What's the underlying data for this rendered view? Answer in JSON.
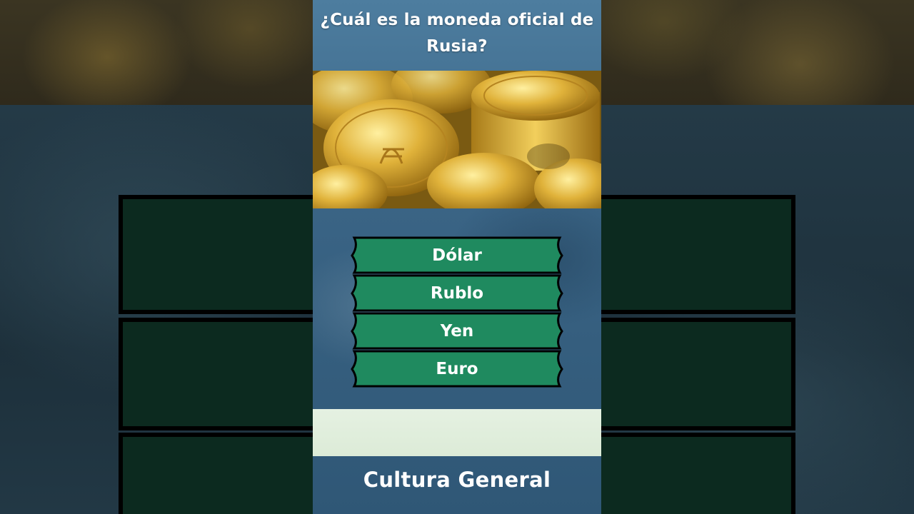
{
  "question": "¿Cuál es la moneda oficial de Rusia?",
  "options": [
    {
      "label": "Dólar"
    },
    {
      "label": "Rublo"
    },
    {
      "label": "Yen"
    },
    {
      "label": "Euro"
    }
  ],
  "footer": "Cultura General",
  "colors": {
    "option_fill": "#1f8a5f",
    "option_border": "#000000",
    "answer_strip": "#e2efdf",
    "panel_blue": "#3a6485"
  },
  "icons": {
    "photo": "gold-coins-image"
  }
}
